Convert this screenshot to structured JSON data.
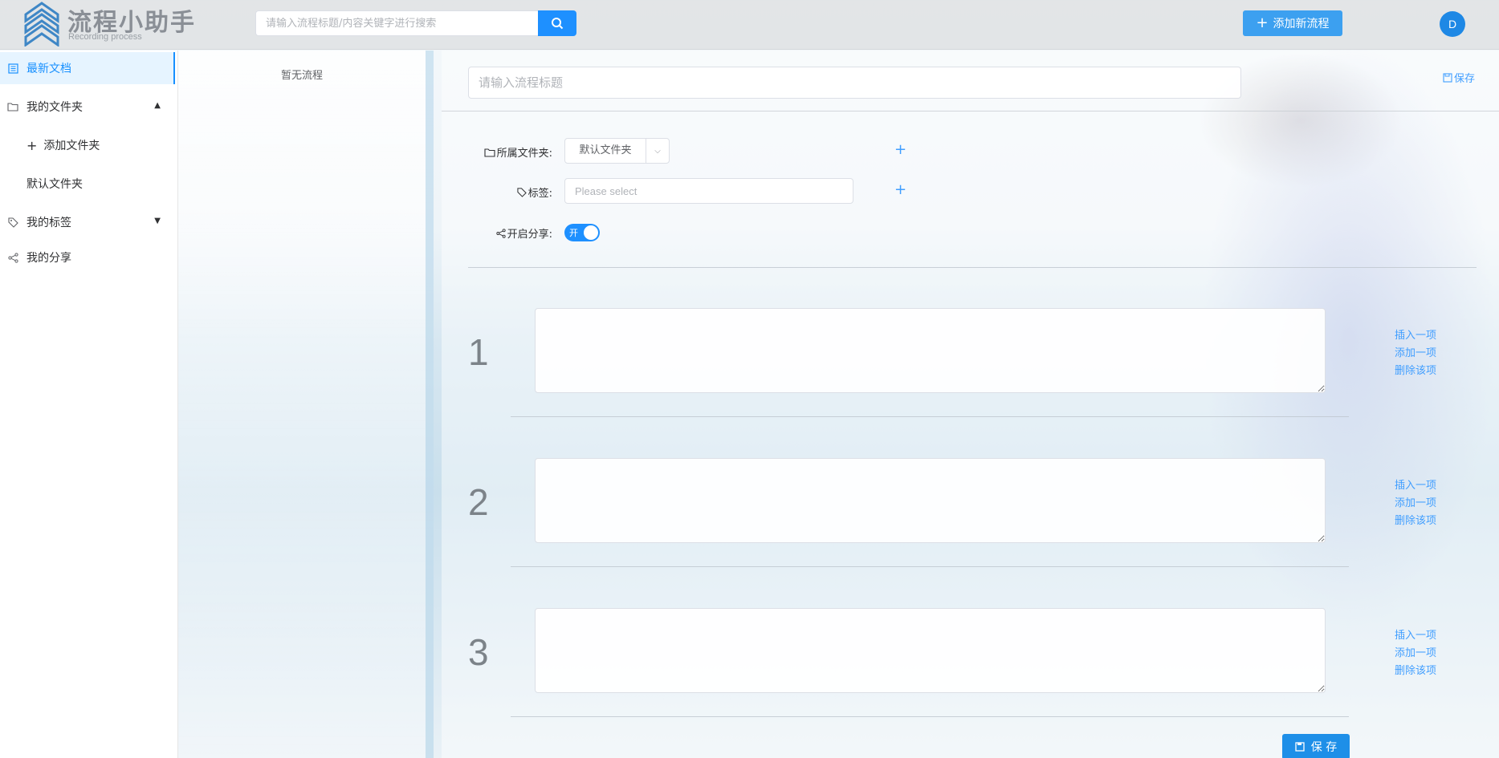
{
  "brand": {
    "title": "流程小助手",
    "subtitle": "Recording process"
  },
  "header": {
    "search_placeholder": "请输入流程标题/内容关键字进行搜索",
    "add_flow_label": "添加新流程",
    "avatar_letter": "D"
  },
  "sidebar": {
    "latest_docs": "最新文档",
    "my_folders": "我的文件夹",
    "add_folder": "添加文件夹",
    "default_folder": "默认文件夹",
    "my_tags": "我的标签",
    "my_shares": "我的分享"
  },
  "list_panel": {
    "empty_text": "暂无流程"
  },
  "editor": {
    "title_placeholder": "请输入流程标题",
    "top_save_label": "保存",
    "folder_label": "所属文件夹:",
    "folder_value": "默认文件夹",
    "tag_label": "标签:",
    "tag_placeholder": "Please select",
    "share_label": "开启分享:",
    "share_switch_text": "开",
    "share_enabled": true,
    "steps": [
      {
        "number": "1",
        "insert": "插入一项",
        "add": "添加一项",
        "delete": "删除该项"
      },
      {
        "number": "2",
        "insert": "插入一项",
        "add": "添加一项",
        "delete": "删除该项"
      },
      {
        "number": "3",
        "insert": "插入一项",
        "add": "添加一项",
        "delete": "删除该项"
      }
    ],
    "bottom_save_label": "保 存"
  },
  "colors": {
    "accent": "#1890ff",
    "primary_button": "#1e90ff",
    "link": "#409eff"
  }
}
